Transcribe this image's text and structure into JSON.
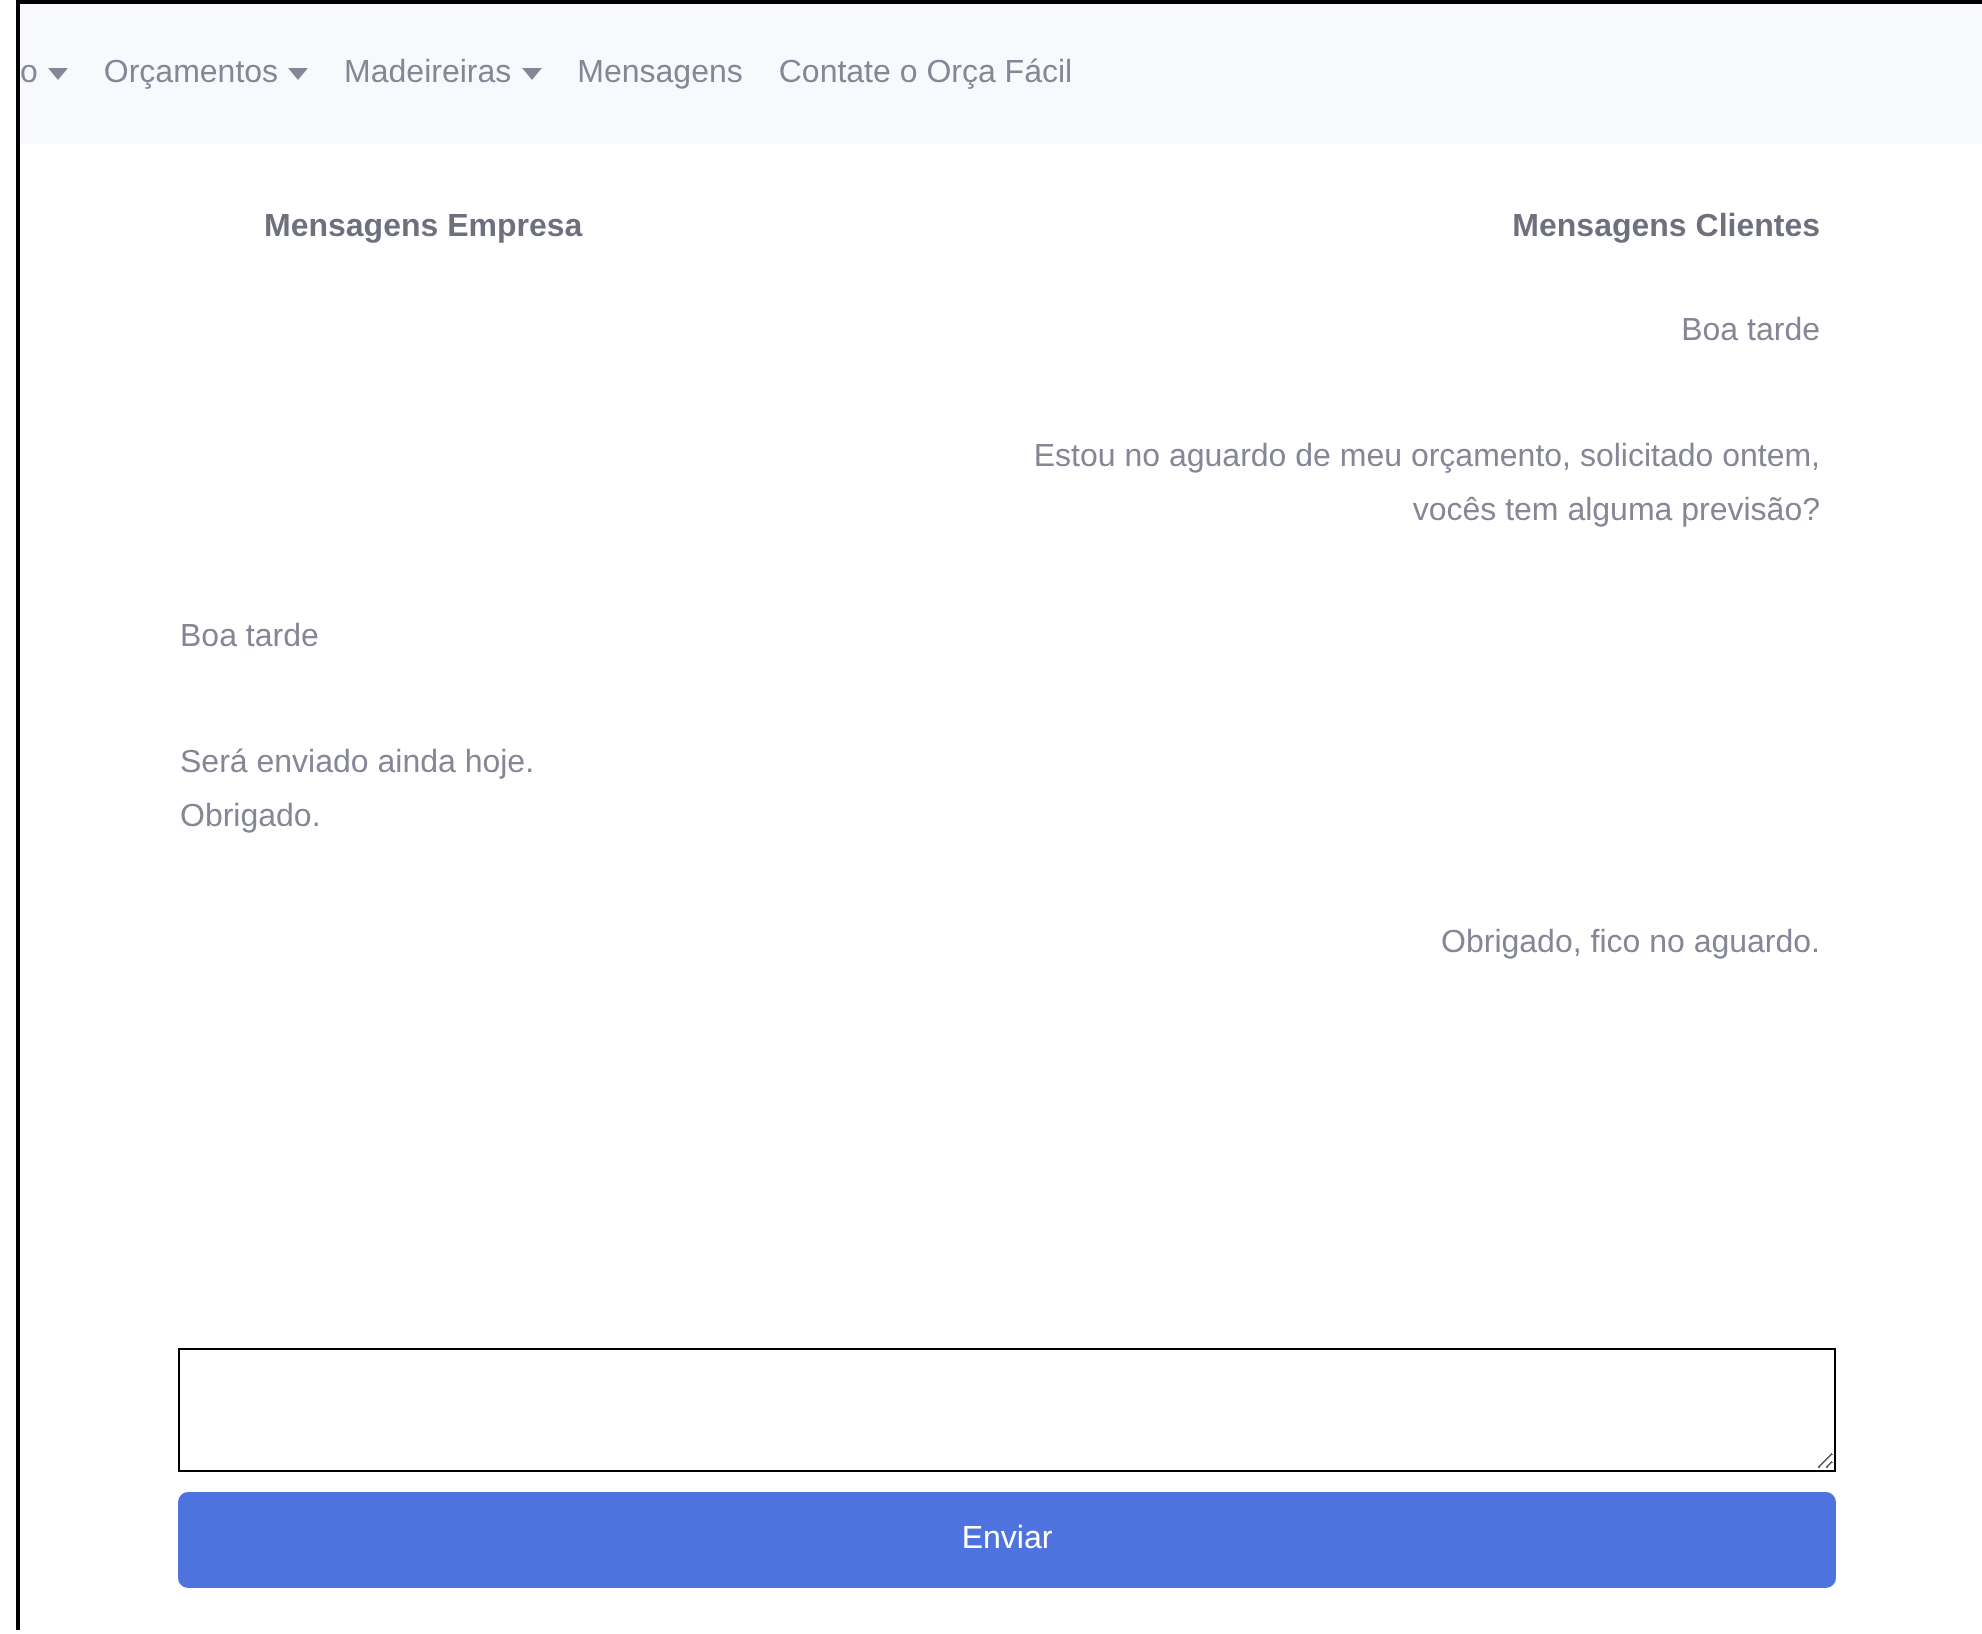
{
  "navbar": {
    "items": [
      {
        "label": "o",
        "dropdown": true
      },
      {
        "label": "Orçamentos",
        "dropdown": true
      },
      {
        "label": "Madeireiras",
        "dropdown": true
      },
      {
        "label": "Mensagens",
        "dropdown": false
      },
      {
        "label": "Contate o Orça Fácil",
        "dropdown": false
      }
    ]
  },
  "chat": {
    "company_heading": "Mensagens Empresa",
    "client_heading": "Mensagens Clientes",
    "messages": [
      {
        "kind": "client",
        "text": "Boa tarde"
      },
      {
        "kind": "client",
        "text": "Estou no aguardo de meu orçamento, solicitado ontem,\nvocês tem alguma previsão?"
      },
      {
        "kind": "company",
        "text": "Boa tarde"
      },
      {
        "kind": "company",
        "text": "Será enviado ainda hoje.\nObrigado."
      },
      {
        "kind": "client",
        "text": "Obrigado, fico no aguardo."
      }
    ],
    "send_button": "Enviar"
  }
}
